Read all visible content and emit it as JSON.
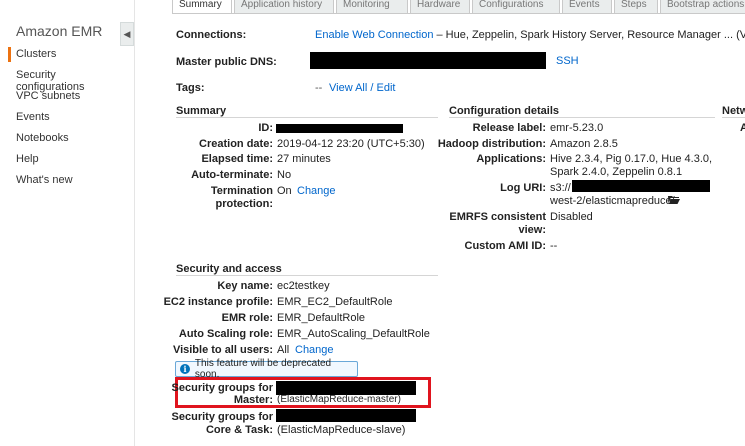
{
  "sidebar": {
    "title": "Amazon EMR",
    "items": [
      {
        "label": "Clusters"
      },
      {
        "label": "Security configurations"
      },
      {
        "label": "VPC subnets"
      },
      {
        "label": "Events"
      },
      {
        "label": "Notebooks"
      },
      {
        "label": "Help"
      },
      {
        "label": "What's new"
      }
    ]
  },
  "tabs": [
    {
      "label": "Summary"
    },
    {
      "label": "Application history"
    },
    {
      "label": "Monitoring"
    },
    {
      "label": "Hardware"
    },
    {
      "label": "Configurations"
    },
    {
      "label": "Events"
    },
    {
      "label": "Steps"
    },
    {
      "label": "Bootstrap actions"
    }
  ],
  "top": {
    "connections_label": "Connections:",
    "connections_link": "Enable Web Connection",
    "connections_text": " – Hue, Zeppelin, Spark History Server, Resource Manager ... ",
    "connections_view_all": "(View All)",
    "dns_label": "Master public DNS:",
    "dns_ssh": "SSH",
    "tags_label": "Tags:",
    "tags_dash": "--",
    "tags_link": "View All / Edit"
  },
  "summary": {
    "title": "Summary",
    "id_label": "ID:",
    "creation_label": "Creation date:",
    "creation_value": "2019-04-12 23:20 (UTC+5:30)",
    "elapsed_label": "Elapsed time:",
    "elapsed_value": "27 minutes",
    "autoterm_label": "Auto-terminate:",
    "autoterm_value": "No",
    "termprot_label_1": "Termination",
    "termprot_label_2": "protection:",
    "termprot_value": "On",
    "termprot_change": "Change"
  },
  "config": {
    "title": "Configuration details",
    "release_label": "Release label:",
    "release_value": "emr-5.23.0",
    "hadoop_label": "Hadoop distribution:",
    "hadoop_value": "Amazon 2.8.5",
    "apps_label": "Applications:",
    "apps_value_1": "Hive 2.3.4, Pig 0.17.0, Hue 4.3.0,",
    "apps_value_2": "Spark 2.4.0, Zeppelin 0.8.1",
    "loguri_label": "Log URI:",
    "loguri_prefix": "s3://",
    "loguri_suffix": "west-2/elasticmapreduce/",
    "emrfs_label_1": "EMRFS consistent",
    "emrfs_label_2": "view:",
    "emrfs_value": "Disabled",
    "ami_label": "Custom AMI ID:",
    "ami_value": "--"
  },
  "network": {
    "title": "Netw",
    "label_fragment": "A"
  },
  "security": {
    "title": "Security and access",
    "key_label": "Key name:",
    "key_value": "ec2testkey",
    "profile_label": "EC2 instance profile:",
    "profile_value": "EMR_EC2_DefaultRole",
    "emrrole_label": "EMR role:",
    "emrrole_value": "EMR_DefaultRole",
    "autoscale_label": "Auto Scaling role:",
    "autoscale_value": "EMR_AutoScaling_DefaultRole",
    "visible_label": "Visible to all users:",
    "visible_value": "All",
    "visible_change": "Change",
    "notice": "This feature will be deprecated soon.",
    "sg_master_label_1": "Security groups for",
    "sg_master_label_2": "Master:",
    "sg_master_value": "(ElasticMapReduce-master)",
    "sg_core_label_1": "Security groups for",
    "sg_core_label_2": "Core & Task:",
    "sg_core_value": "(ElasticMapReduce-slave)"
  },
  "colors": {
    "link": "#0066cc",
    "accent": "#ec7211",
    "highlight": "#e0141e"
  }
}
